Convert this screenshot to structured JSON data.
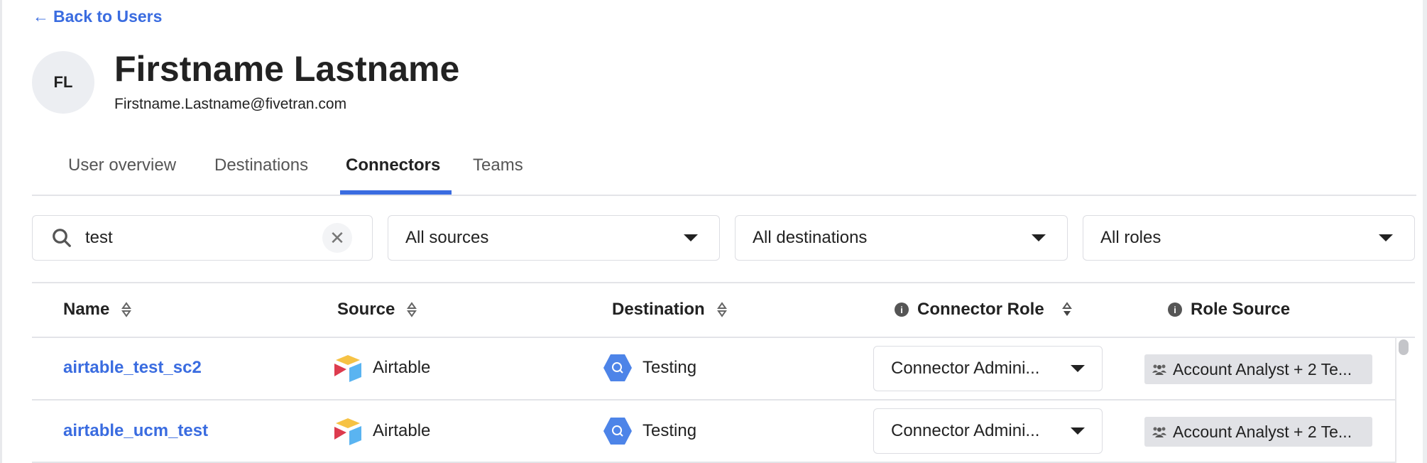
{
  "nav": {
    "back_label": "Back to Users"
  },
  "user": {
    "initials": "FL",
    "name": "Firstname Lastname",
    "email": "Firstname.Lastname@fivetran.com"
  },
  "tabs": [
    {
      "label": "User overview"
    },
    {
      "label": "Destinations"
    },
    {
      "label": "Connectors",
      "active": true
    },
    {
      "label": "Teams"
    }
  ],
  "filters": {
    "search_value": "test",
    "sources": "All sources",
    "destinations": "All destinations",
    "roles": "All roles"
  },
  "table": {
    "columns": [
      "Name",
      "Source",
      "Destination",
      "Connector Role",
      "Role Source"
    ],
    "rows": [
      {
        "name": "airtable_test_sc2",
        "source": "Airtable",
        "destination": "Testing",
        "role": "Connector Admini...",
        "role_source": "Account Analyst + 2 Te..."
      },
      {
        "name": "airtable_ucm_test",
        "source": "Airtable",
        "destination": "Testing",
        "role": "Connector Admini...",
        "role_source": "Account Analyst + 2 Te..."
      }
    ]
  },
  "colors": {
    "accent": "#3a6ce0",
    "badge": "#e1e2e6"
  }
}
